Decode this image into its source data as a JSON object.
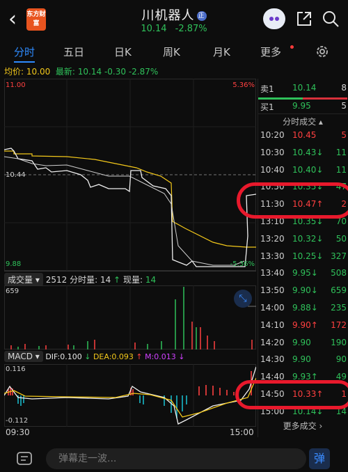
{
  "header": {
    "back_label": "‹",
    "logo_text": "东方财富",
    "stock_name": "川机器人",
    "name_tag": "正",
    "price": "10.14",
    "change_pct": "-2.87%"
  },
  "tabs": [
    "分时",
    "五日",
    "日K",
    "周K",
    "月K",
    "更多"
  ],
  "avg_row": {
    "avg_label": "均价:",
    "avg_value": "10.00",
    "latest_label": "最新:",
    "latest_value": "10.14",
    "change": "-0.30",
    "change_pct": "-2.87%"
  },
  "price_axis": {
    "top": "11.00",
    "top_pct": "5.36%",
    "mid": "10.44",
    "bottom": "9.88",
    "bottom_pct": "-5.36%"
  },
  "volume": {
    "selector": "成交量",
    "total_label": "2512",
    "fenshi_label": "分时量:",
    "fenshi_value": "14",
    "current_label": "现量:",
    "current_value": "14",
    "max_label": "659"
  },
  "macd": {
    "selector": "MACD",
    "dif": "DIF:0.100",
    "dea": "DEA:0.093",
    "m": "M:0.013",
    "top": "0.116",
    "bottom": "-0.112"
  },
  "time_axis": {
    "start": "09:30",
    "end": "15:00"
  },
  "order_book": [
    {
      "label": "卖1",
      "price": "10.14",
      "vol": "8"
    },
    {
      "label": "买1",
      "price": "9.95",
      "vol": "5"
    }
  ],
  "trades_header": "分时成交",
  "trades": [
    {
      "time": "10:20",
      "price": "10.45",
      "arrow": "",
      "vol": "5",
      "color": "red"
    },
    {
      "time": "10:30",
      "price": "10.43",
      "arrow": "↓",
      "vol": "11",
      "color": "green"
    },
    {
      "time": "10:40",
      "price": "10.40",
      "arrow": "↓",
      "vol": "11",
      "color": "green"
    },
    {
      "time": "10:50",
      "price": "10.35",
      "arrow": "↓",
      "vol": "47",
      "color": "green"
    },
    {
      "time": "11:30",
      "price": "10.47",
      "arrow": "↑",
      "vol": "2",
      "color": "red"
    },
    {
      "time": "13:10",
      "price": "10.35",
      "arrow": "↓",
      "vol": "70",
      "color": "green"
    },
    {
      "time": "13:20",
      "price": "10.32",
      "arrow": "↓",
      "vol": "50",
      "color": "green"
    },
    {
      "time": "13:30",
      "price": "10.25",
      "arrow": "↓",
      "vol": "327",
      "color": "green"
    },
    {
      "time": "13:40",
      "price": "9.95",
      "arrow": "↓",
      "vol": "508",
      "color": "green"
    },
    {
      "time": "13:50",
      "price": "9.90",
      "arrow": "↓",
      "vol": "659",
      "color": "green"
    },
    {
      "time": "14:00",
      "price": "9.88",
      "arrow": "↓",
      "vol": "235",
      "color": "green"
    },
    {
      "time": "14:10",
      "price": "9.90",
      "arrow": "↑",
      "vol": "172",
      "color": "red"
    },
    {
      "time": "14:20",
      "price": "9.90",
      "arrow": "",
      "vol": "190",
      "color": "green"
    },
    {
      "time": "14:30",
      "price": "9.90",
      "arrow": "",
      "vol": "90",
      "color": "green"
    },
    {
      "time": "14:40",
      "price": "9.93",
      "arrow": "↑",
      "vol": "49",
      "color": "green"
    },
    {
      "time": "14:50",
      "price": "10.33",
      "arrow": "↑",
      "vol": "1",
      "color": "red"
    },
    {
      "time": "15:00",
      "price": "10.14",
      "arrow": "↓",
      "vol": "14",
      "color": "green"
    }
  ],
  "more_trades": "更多成交",
  "danmu_placeholder": "弹幕走一波...",
  "danmu_toggle": "弹",
  "colors": {
    "up": "#ff4040",
    "down": "#2fc15a",
    "avg": "#f3c81a",
    "accent": "#2e8bff"
  }
}
